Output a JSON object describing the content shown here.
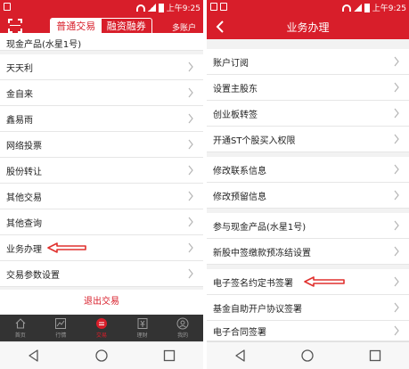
{
  "colors": {
    "brand_red": "#d81e2a",
    "arrow_red": "#e0312e",
    "tabbar_bg": "#333333"
  },
  "status": {
    "time": "上午9:25"
  },
  "left": {
    "segment": {
      "active": "普通交易",
      "inactive": "融资融券"
    },
    "multi_account": "多账户",
    "partial_item": "现金产品(水星1号)",
    "items": [
      {
        "label": "天天利"
      },
      {
        "label": "金自来"
      },
      {
        "label": "鑫易雨"
      },
      {
        "label": "网络投票"
      },
      {
        "label": "股份转让"
      },
      {
        "label": "其他交易"
      },
      {
        "label": "其他查询"
      },
      {
        "label": "业务办理"
      },
      {
        "label": "交易参数设置"
      }
    ],
    "logout": "退出交易",
    "tabs": [
      {
        "label": "首页",
        "icon": "home-icon"
      },
      {
        "label": "行情",
        "icon": "chart-icon"
      },
      {
        "label": "交易",
        "icon": "trade-icon"
      },
      {
        "label": "理财",
        "icon": "finance-icon"
      },
      {
        "label": "我的",
        "icon": "user-icon"
      }
    ]
  },
  "right": {
    "title": "业务办理",
    "items": [
      {
        "label": "账户订阅"
      },
      {
        "label": "设置主股东"
      },
      {
        "label": "创业板转签"
      },
      {
        "label": "开通ST个股买入权限"
      },
      {
        "label": "修改联系信息"
      },
      {
        "label": "修改预留信息"
      },
      {
        "label": "参与现金产品(水星1号)"
      },
      {
        "label": "新股中签缴款预冻结设置"
      },
      {
        "label": "电子签名约定书签署"
      },
      {
        "label": "基金自助开户协议签署"
      },
      {
        "label": "电子合同签署"
      }
    ]
  }
}
